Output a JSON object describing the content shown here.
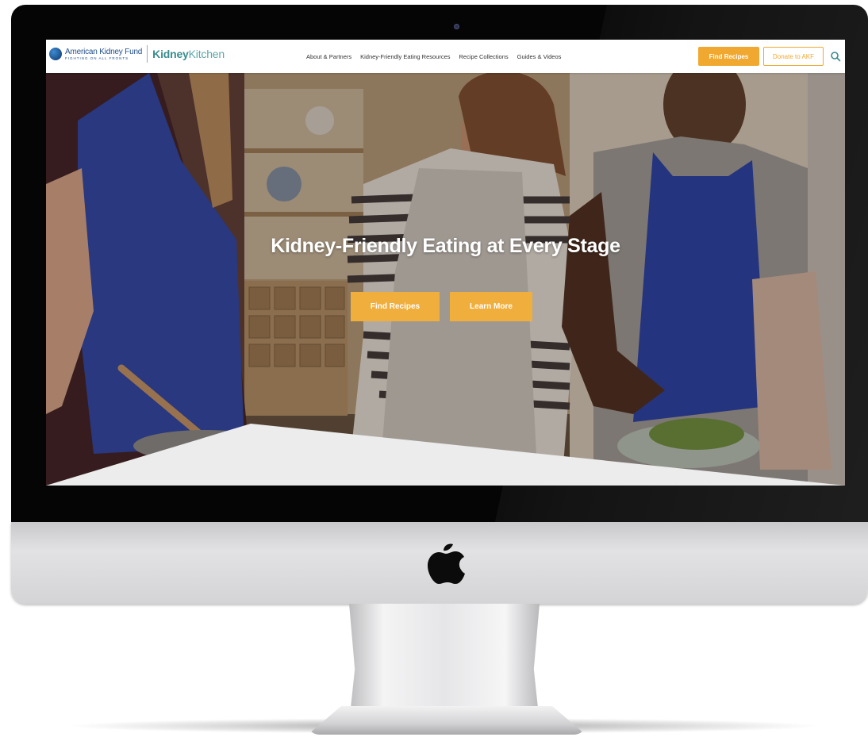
{
  "site": {
    "org_name": "American Kidney Fund",
    "org_tagline": "FIGHTING ON ALL FRONTS",
    "brand_primary": "Kidney",
    "brand_secondary": "Kitchen",
    "colors": {
      "accent": "#f0a830",
      "brand_teal": "#3a8c8f",
      "org_blue": "#1f4f8c"
    }
  },
  "nav": {
    "links": [
      "About & Partners",
      "Kidney-Friendly Eating Resources",
      "Recipe Collections",
      "Guides & Videos"
    ],
    "find_recipes": "Find Recipes",
    "donate": "Donate to AKF",
    "search_icon": "search-icon"
  },
  "hero": {
    "title": "Kidney-Friendly Eating at Every Stage",
    "buttons": {
      "find_recipes": "Find Recipes",
      "learn_more": "Learn More"
    }
  },
  "device": {
    "logo_icon": "apple-logo-icon"
  }
}
